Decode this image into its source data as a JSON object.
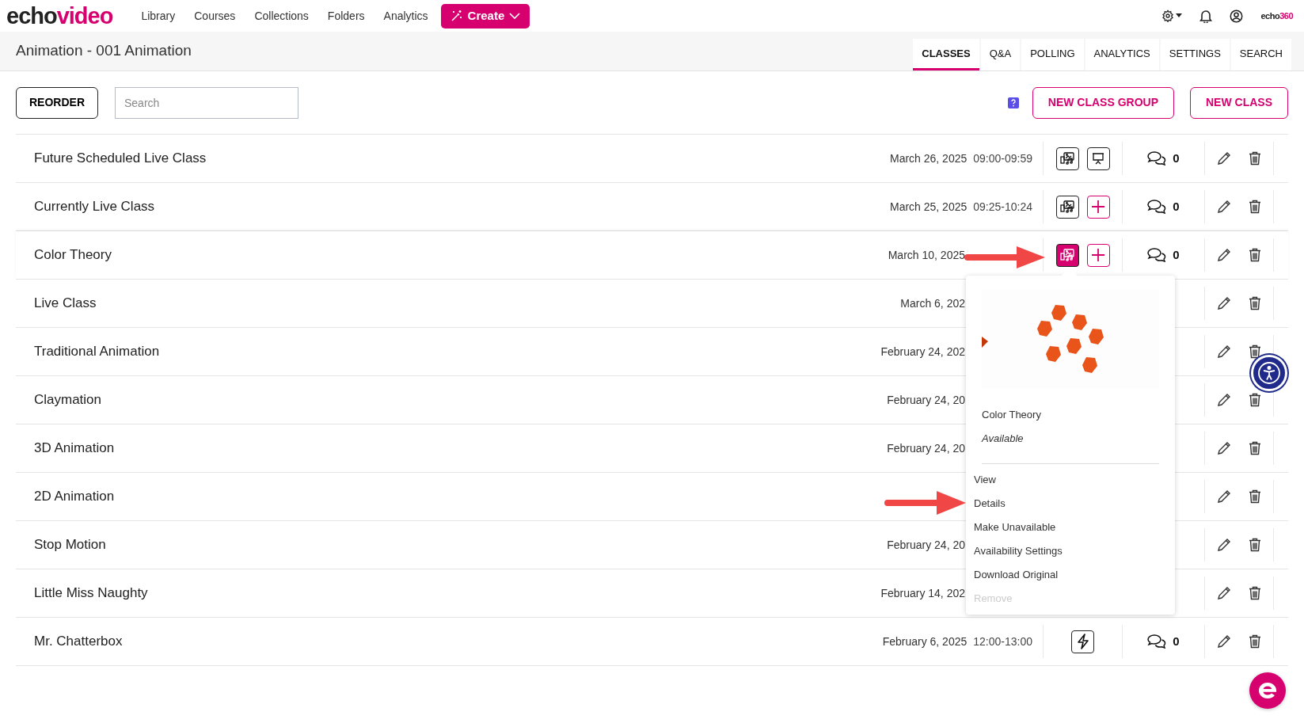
{
  "nav": {
    "logo": [
      "echo",
      "video"
    ],
    "links": [
      "Library",
      "Courses",
      "Collections",
      "Folders",
      "Analytics"
    ],
    "create": "Create",
    "brand": [
      "echo",
      "360"
    ]
  },
  "course": {
    "title": "Animation - 001 Animation"
  },
  "tabs": [
    {
      "label": "CLASSES",
      "selected": true
    },
    {
      "label": "Q&A",
      "selected": false
    },
    {
      "label": "POLLING",
      "selected": false
    },
    {
      "label": "ANALYTICS",
      "selected": false
    },
    {
      "label": "SETTINGS",
      "selected": false
    },
    {
      "label": "SEARCH",
      "selected": false
    }
  ],
  "toolbar": {
    "reorder": "REORDER",
    "search_placeholder": "Search",
    "buttons": [
      "NEW CLASS GROUP",
      "NEW CLASS"
    ]
  },
  "classes": [
    {
      "title": "Future Scheduled Live Class",
      "date": "March 26, 2025",
      "time": "09:00-09:59",
      "media": [
        {
          "kind": "recording",
          "selected": false
        },
        {
          "kind": "present",
          "selected": false
        }
      ],
      "comments": "0"
    },
    {
      "title": "Currently Live Class",
      "date": "March 25, 2025",
      "time": "09:25-10:24",
      "media": [
        {
          "kind": "recording",
          "selected": false
        },
        {
          "kind": "add",
          "selected": false
        }
      ],
      "comments": "0"
    },
    {
      "title": "Color Theory",
      "date": "March 10, 2025",
      "media": [
        {
          "kind": "recording",
          "selected": true
        },
        {
          "kind": "add",
          "selected": false
        }
      ],
      "comments": "0"
    },
    {
      "title": "Live Class",
      "date": "March 6, 202"
    },
    {
      "title": "Traditional Animation",
      "date": "February 24, 202"
    },
    {
      "title": "Claymation",
      "date": "February 24, 20"
    },
    {
      "title": "3D Animation",
      "date": "February 24, 20"
    },
    {
      "title": "2D Animation"
    },
    {
      "title": "Stop Motion",
      "date": "February 24, 20"
    },
    {
      "title": "Little Miss Naughty",
      "date": "February 14, 202"
    },
    {
      "title": "Mr. Chatterbox",
      "date": "February 6, 2025",
      "time": "12:00-13:00",
      "media": [
        {
          "kind": "live",
          "selected": false
        }
      ],
      "comments": "0"
    }
  ],
  "popup": {
    "title": "Color Theory",
    "status": "Available",
    "items": [
      {
        "label": "View",
        "disabled": false
      },
      {
        "label": "Details",
        "disabled": false
      },
      {
        "label": "Make Unavailable",
        "disabled": false
      },
      {
        "label": "Availability Settings",
        "disabled": false
      },
      {
        "label": "Download Original",
        "disabled": false
      },
      {
        "label": "Remove",
        "disabled": true
      }
    ]
  }
}
